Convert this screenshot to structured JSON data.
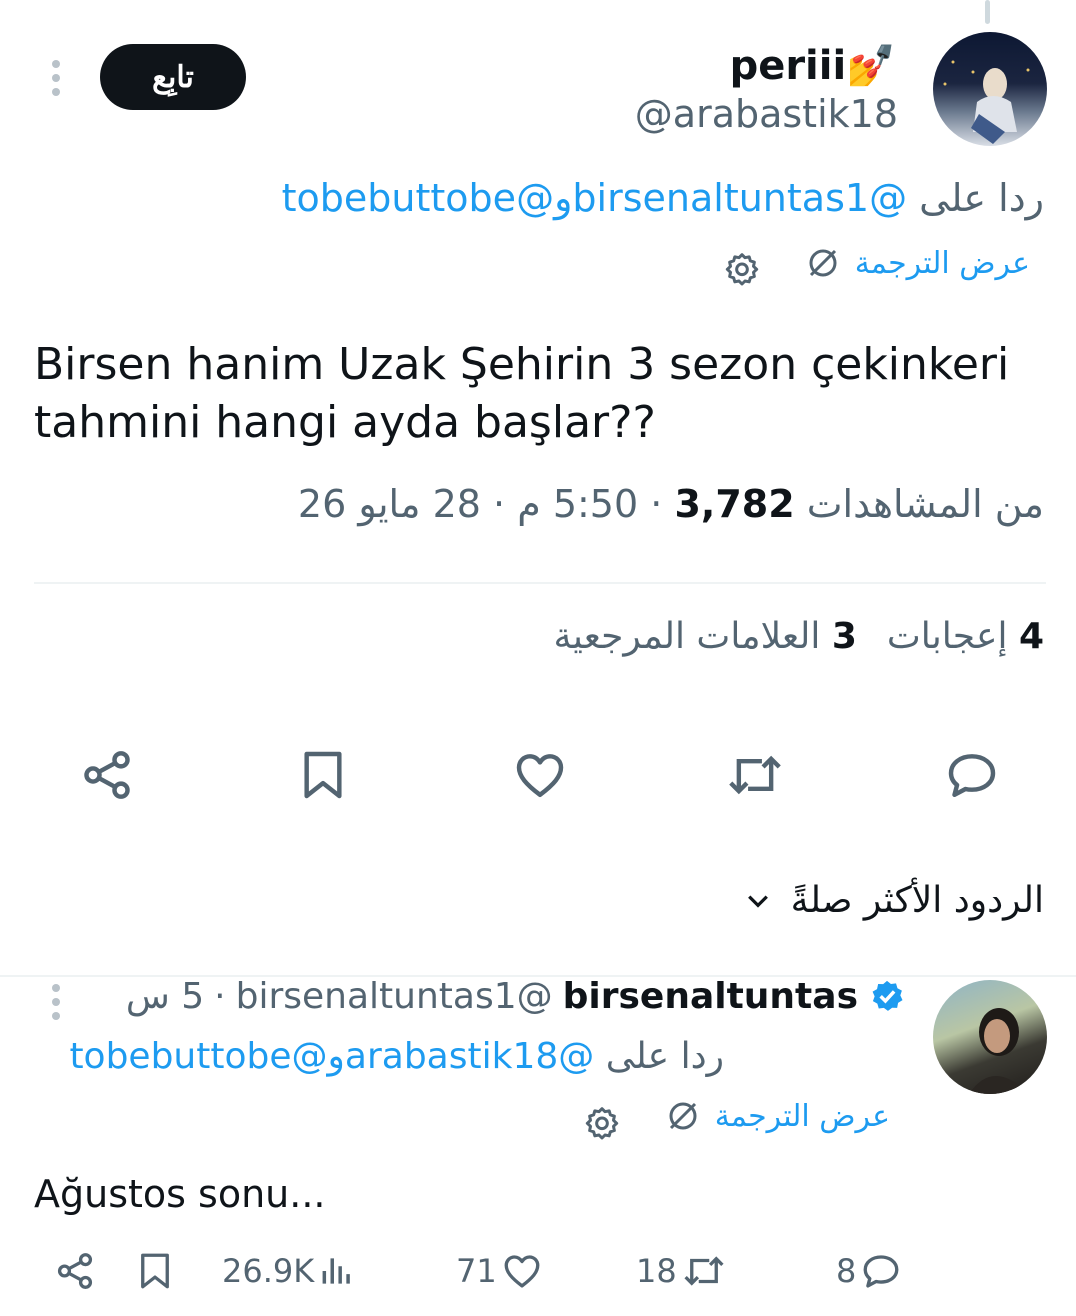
{
  "tweet": {
    "display_name": "periii",
    "name_emoji": "💅",
    "handle": "@arabastik18",
    "follow_label": "تابِع",
    "reply_prefix": "ردا على",
    "reply_to_1": "@birsenaltuntas1",
    "reply_joiner": "و",
    "reply_to_2": "@tobebuttobe",
    "translate_label": "عرض الترجمة",
    "text": "Birsen hanim Uzak Şehirin 3 sezon çekinkeri tahmini hangi ayda başlar??",
    "time": "5:50 م",
    "date": "28 مايو 26",
    "views_count": "3,782",
    "views_label": "من المشاهدات",
    "likes_count": "4",
    "likes_label": "إعجابات",
    "bookmarks_count": "3",
    "bookmarks_label": "العلامات المرجعية",
    "sep": "·"
  },
  "sort": {
    "label": "الردود الأكثر صلةً"
  },
  "reply": {
    "display_name": "birsenaltuntas",
    "handle": "@birsenaltuntas1",
    "age": "5 س",
    "reply_prefix": "ردا على",
    "reply_to_1": "@arabastik18",
    "reply_joiner": "و",
    "reply_to_2": "@tobebuttobe",
    "translate_label": "عرض الترجمة",
    "text": "Ağustos sonu...",
    "views": "26.9K",
    "likes": "71",
    "retweets": "18",
    "replies": "8"
  },
  "icons": [
    "more-icon",
    "gear-icon",
    "translate-icon",
    "share-icon",
    "bookmark-icon",
    "like-icon",
    "retweet-icon",
    "reply-icon",
    "chevron-down-icon",
    "verified-icon",
    "views-icon"
  ],
  "colors": {
    "link": "#1d9bf0",
    "muted": "#536471",
    "text": "#0f1419",
    "follow_bg": "#0f1419"
  }
}
